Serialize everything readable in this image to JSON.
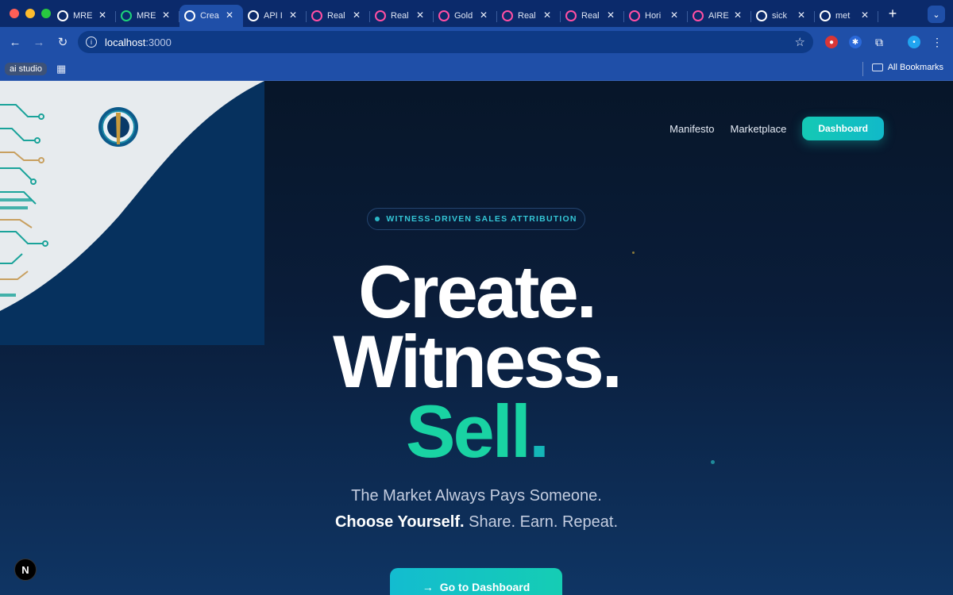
{
  "browser": {
    "tabs": [
      {
        "title": "MRE",
        "favicon": "circle-logo-icon",
        "color": "#ffffff"
      },
      {
        "title": "MRE",
        "favicon": "bolt-icon",
        "color": "#1dd27a"
      },
      {
        "title": "Crea",
        "favicon": "triangle-icon",
        "color": "#ffffff",
        "active": true
      },
      {
        "title": "API I",
        "favicon": "refresh-square-icon",
        "color": "#ffffff"
      },
      {
        "title": "Real",
        "favicon": "pink-dots-icon",
        "color": "#ff4fa3"
      },
      {
        "title": "Real",
        "favicon": "pink-dots-icon",
        "color": "#ff4fa3"
      },
      {
        "title": "Gold",
        "favicon": "pink-dots-icon",
        "color": "#ff4fa3"
      },
      {
        "title": "Real",
        "favicon": "pink-dots-icon",
        "color": "#ff4fa3"
      },
      {
        "title": "Real",
        "favicon": "pink-dots-icon",
        "color": "#ff4fa3"
      },
      {
        "title": "Hori",
        "favicon": "pink-dots-icon",
        "color": "#ff4fa3"
      },
      {
        "title": "AIRE",
        "favicon": "pink-dots-icon",
        "color": "#ff4fa3"
      },
      {
        "title": "sick",
        "favicon": "github-icon",
        "color": "#ffffff"
      },
      {
        "title": "met",
        "favicon": "google-icon",
        "color": "#ffffff"
      }
    ],
    "url_host": "localhost",
    "url_port": ":3000",
    "bookmark_chip": "ai studio",
    "all_bookmarks": "All Bookmarks"
  },
  "nav": {
    "links": [
      "Manifesto",
      "Marketplace"
    ],
    "dashboard_label": "Dashboard"
  },
  "hero": {
    "badge": "WITNESS-DRIVEN SALES ATTRIBUTION",
    "line1": "Create.",
    "line2": "Witness.",
    "line3_word": "Sell",
    "line3_dot": ".",
    "sub1": "The Market Always Pays Someone.",
    "sub2_bold": "Choose Yourself.",
    "sub2_rest": " Share. Earn. Repeat.",
    "cta": "Go to Dashboard"
  },
  "footer": {
    "dev_badge": "N"
  },
  "colors": {
    "accent_green": "#19d3a3",
    "accent_teal": "#14c9b4",
    "chrome_blue": "#1f4fa8"
  }
}
